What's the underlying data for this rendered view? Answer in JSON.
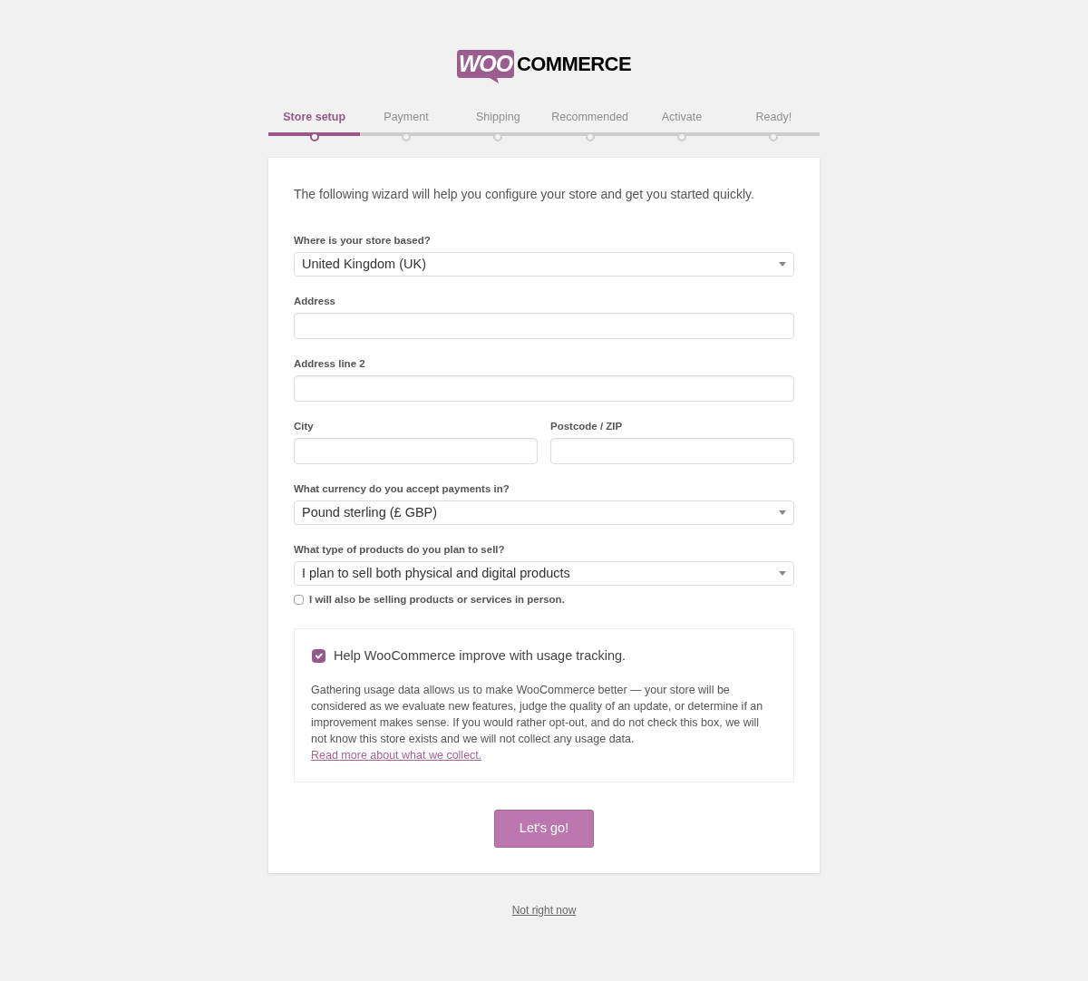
{
  "logo": {
    "badge": "WOO",
    "wordmark": "COMMERCE"
  },
  "steps": [
    {
      "label": "Store setup",
      "selected": true
    },
    {
      "label": "Payment",
      "selected": false
    },
    {
      "label": "Shipping",
      "selected": false
    },
    {
      "label": "Recommended",
      "selected": false
    },
    {
      "label": "Activate",
      "selected": false
    },
    {
      "label": "Ready!",
      "selected": false
    }
  ],
  "intro": "The following wizard will help you configure your store and get you started quickly.",
  "field_rows": [
    {
      "fields": [
        {
          "kind": "select",
          "label": "Where is your store based?",
          "value": "United Kingdom (UK)"
        }
      ]
    },
    {
      "fields": [
        {
          "kind": "text",
          "label": "Address"
        }
      ]
    },
    {
      "fields": [
        {
          "kind": "text",
          "label": "Address line 2"
        }
      ]
    },
    {
      "fields": [
        {
          "kind": "text",
          "label": "City"
        },
        {
          "kind": "text",
          "label": "Postcode / ZIP"
        }
      ]
    },
    {
      "fields": [
        {
          "kind": "select",
          "label": "What currency do you accept payments in?",
          "value": "Pound sterling (£ GBP)"
        }
      ]
    },
    {
      "fields": [
        {
          "kind": "select",
          "label": "What type of products do you plan to sell?",
          "value": "I plan to sell both physical and digital products"
        }
      ]
    }
  ],
  "in_person": {
    "label": "I will also be selling products or services in person.",
    "checked": false
  },
  "usage_tracking": {
    "label": "Help WooCommerce improve with usage tracking.",
    "checked": true,
    "text": "Gathering usage data allows us to make WooCommerce better — your store will be considered as we evaluate new features, judge the quality of an update, or determine if an improvement makes sense. If you would rather opt-out, and do not check this box, we will not know this store exists and we will not collect any usage data.",
    "link": "Read more about what we collect."
  },
  "submit_button": "Let's go!",
  "skip_link": "Not right now"
}
